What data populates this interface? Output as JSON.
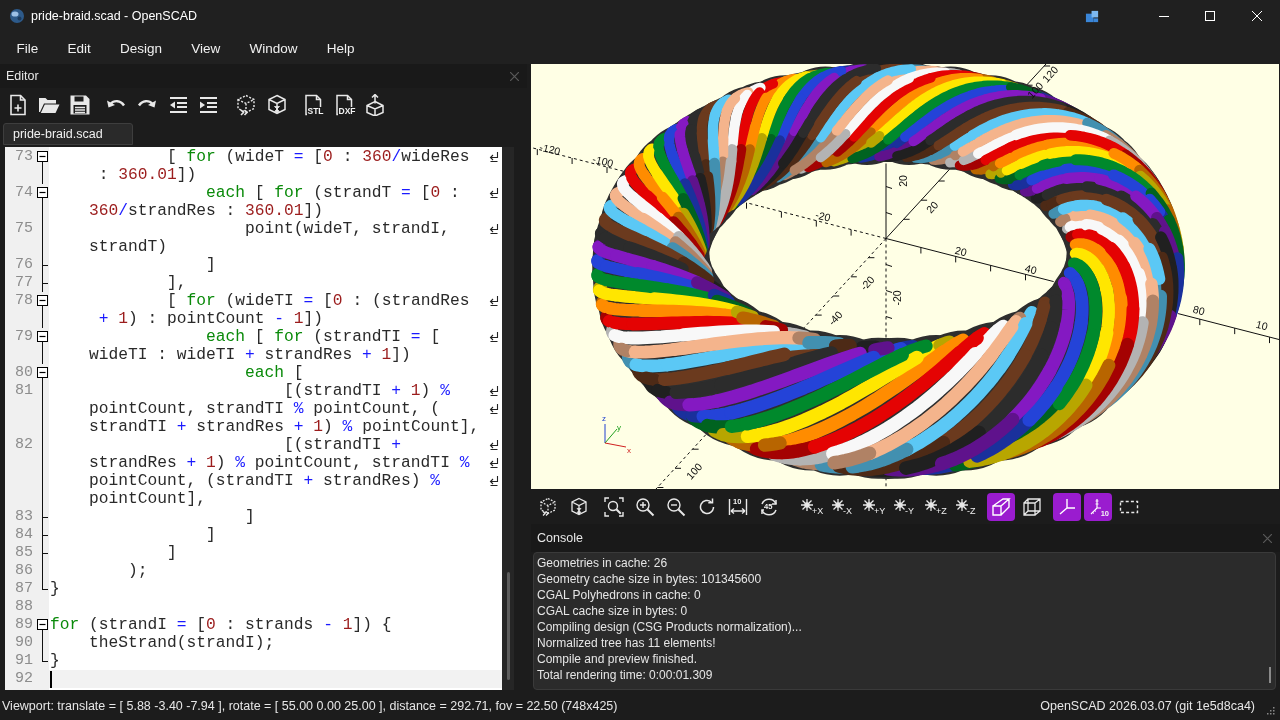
{
  "window": {
    "title": "pride-braid.scad - OpenSCAD"
  },
  "menu": [
    "File",
    "Edit",
    "Design",
    "View",
    "Window",
    "Help"
  ],
  "editor": {
    "title": "Editor",
    "export_buttons": [
      {
        "label": "STL"
      },
      {
        "label": "DXF"
      }
    ],
    "tabs": [
      {
        "label": "pride-braid.scad",
        "selected": true
      }
    ],
    "lines": [
      {
        "number": "73",
        "fold": {
          "kind": "toggle",
          "expanded": true
        },
        "current": false,
        "segments": [
          [
            {
              "kind": "text",
              "text": "            [ "
            },
            {
              "kind": "keyword",
              "text": "for"
            },
            {
              "kind": "text",
              "text": " (wideT "
            },
            {
              "kind": "operator",
              "text": "="
            },
            {
              "kind": "text",
              "text": " ["
            },
            {
              "kind": "number",
              "text": "0"
            },
            {
              "kind": "text",
              "text": " : "
            },
            {
              "kind": "number",
              "text": "360"
            },
            {
              "kind": "operator",
              "text": "/"
            },
            {
              "kind": "text",
              "text": "wideRes"
            }
          ],
          [
            {
              "kind": "text",
              "text": " : "
            },
            {
              "kind": "number",
              "text": "360.01"
            },
            {
              "kind": "text",
              "text": "])"
            }
          ]
        ]
      },
      {
        "number": "74",
        "fold": {
          "kind": "toggle",
          "expanded": true
        },
        "current": false,
        "segments": [
          [
            {
              "kind": "keyword",
              "text": "                each"
            },
            {
              "kind": "text",
              "text": " [ "
            },
            {
              "kind": "keyword",
              "text": "for"
            },
            {
              "kind": "text",
              "text": " (strandT "
            },
            {
              "kind": "operator",
              "text": "="
            },
            {
              "kind": "text",
              "text": " ["
            },
            {
              "kind": "number",
              "text": "0"
            },
            {
              "kind": "text",
              "text": " :"
            }
          ],
          [
            {
              "kind": "number",
              "text": "360"
            },
            {
              "kind": "operator",
              "text": "/"
            },
            {
              "kind": "text",
              "text": "strandRes : "
            },
            {
              "kind": "number",
              "text": "360.01"
            },
            {
              "kind": "text",
              "text": "])"
            }
          ]
        ]
      },
      {
        "number": "75",
        "fold": {
          "kind": "inside"
        },
        "current": false,
        "segments": [
          [
            {
              "kind": "text",
              "text": "                    point(wideT, strandI,"
            }
          ],
          [
            {
              "kind": "text",
              "text": "strandT)"
            }
          ]
        ]
      },
      {
        "number": "76",
        "fold": {
          "kind": "branch"
        },
        "current": false,
        "segments": [
          [
            {
              "kind": "text",
              "text": "                ]"
            }
          ]
        ]
      },
      {
        "number": "77",
        "fold": {
          "kind": "branch"
        },
        "current": false,
        "segments": [
          [
            {
              "kind": "text",
              "text": "            ],"
            }
          ]
        ]
      },
      {
        "number": "78",
        "fold": {
          "kind": "toggle",
          "expanded": true
        },
        "current": false,
        "segments": [
          [
            {
              "kind": "text",
              "text": "            [ "
            },
            {
              "kind": "keyword",
              "text": "for"
            },
            {
              "kind": "text",
              "text": " (wideTI "
            },
            {
              "kind": "operator",
              "text": "="
            },
            {
              "kind": "text",
              "text": " ["
            },
            {
              "kind": "number",
              "text": "0"
            },
            {
              "kind": "text",
              "text": " : (strandRes"
            }
          ],
          [
            {
              "kind": "operator",
              "text": " +"
            },
            {
              "kind": "number",
              "text": " 1"
            },
            {
              "kind": "text",
              "text": ") : pointCount "
            },
            {
              "kind": "operator",
              "text": "-"
            },
            {
              "kind": "number",
              "text": " 1"
            },
            {
              "kind": "text",
              "text": "])"
            }
          ]
        ]
      },
      {
        "number": "79",
        "fold": {
          "kind": "toggle",
          "expanded": true
        },
        "current": false,
        "segments": [
          [
            {
              "kind": "keyword",
              "text": "                each"
            },
            {
              "kind": "text",
              "text": " [ "
            },
            {
              "kind": "keyword",
              "text": "for"
            },
            {
              "kind": "text",
              "text": " (strandTI "
            },
            {
              "kind": "operator",
              "text": "="
            },
            {
              "kind": "text",
              "text": " ["
            }
          ],
          [
            {
              "kind": "text",
              "text": "wideTI : wideTI "
            },
            {
              "kind": "operator",
              "text": "+"
            },
            {
              "kind": "text",
              "text": " strandRes "
            },
            {
              "kind": "operator",
              "text": "+"
            },
            {
              "kind": "number",
              "text": " 1"
            },
            {
              "kind": "text",
              "text": "])"
            }
          ]
        ]
      },
      {
        "number": "80",
        "fold": {
          "kind": "toggle",
          "expanded": true
        },
        "current": false,
        "segments": [
          [
            {
              "kind": "keyword",
              "text": "                    each"
            },
            {
              "kind": "text",
              "text": " ["
            }
          ]
        ]
      },
      {
        "number": "81",
        "fold": {
          "kind": "inside"
        },
        "current": false,
        "segments": [
          [
            {
              "kind": "text",
              "text": "                        [(strandTI "
            },
            {
              "kind": "operator",
              "text": "+"
            },
            {
              "kind": "number",
              "text": " 1"
            },
            {
              "kind": "text",
              "text": ") "
            },
            {
              "kind": "operator",
              "text": "%"
            }
          ],
          [
            {
              "kind": "text",
              "text": "pointCount, strandTI "
            },
            {
              "kind": "operator",
              "text": "%"
            },
            {
              "kind": "text",
              "text": " pointCount, ("
            }
          ],
          [
            {
              "kind": "text",
              "text": "strandTI "
            },
            {
              "kind": "operator",
              "text": "+"
            },
            {
              "kind": "text",
              "text": " strandRes "
            },
            {
              "kind": "operator",
              "text": "+"
            },
            {
              "kind": "number",
              "text": " 1"
            },
            {
              "kind": "text",
              "text": ") "
            },
            {
              "kind": "operator",
              "text": "%"
            },
            {
              "kind": "text",
              "text": " pointCount],"
            }
          ]
        ]
      },
      {
        "number": "82",
        "fold": {
          "kind": "inside"
        },
        "current": false,
        "segments": [
          [
            {
              "kind": "text",
              "text": "                        [(strandTI "
            },
            {
              "kind": "operator",
              "text": "+"
            }
          ],
          [
            {
              "kind": "text",
              "text": "strandRes "
            },
            {
              "kind": "operator",
              "text": "+"
            },
            {
              "kind": "number",
              "text": " 1"
            },
            {
              "kind": "text",
              "text": ") "
            },
            {
              "kind": "operator",
              "text": "%"
            },
            {
              "kind": "text",
              "text": " pointCount, strandTI "
            },
            {
              "kind": "operator",
              "text": "%"
            }
          ],
          [
            {
              "kind": "text",
              "text": "pointCount, (strandTI "
            },
            {
              "kind": "operator",
              "text": "+"
            },
            {
              "kind": "text",
              "text": " strandRes) "
            },
            {
              "kind": "operator",
              "text": "%"
            }
          ],
          [
            {
              "kind": "text",
              "text": "pointCount],"
            }
          ]
        ]
      },
      {
        "number": "83",
        "fold": {
          "kind": "branch"
        },
        "current": false,
        "segments": [
          [
            {
              "kind": "text",
              "text": "                    ]"
            }
          ]
        ]
      },
      {
        "number": "84",
        "fold": {
          "kind": "branch"
        },
        "current": false,
        "segments": [
          [
            {
              "kind": "text",
              "text": "                ]"
            }
          ]
        ]
      },
      {
        "number": "85",
        "fold": {
          "kind": "branch"
        },
        "current": false,
        "segments": [
          [
            {
              "kind": "text",
              "text": "            ]"
            }
          ]
        ]
      },
      {
        "number": "86",
        "fold": {
          "kind": "inside"
        },
        "current": false,
        "segments": [
          [
            {
              "kind": "text",
              "text": "        );"
            }
          ]
        ]
      },
      {
        "number": "87",
        "fold": {
          "kind": "end"
        },
        "current": false,
        "segments": [
          [
            {
              "kind": "text",
              "text": "}"
            }
          ]
        ]
      },
      {
        "number": "88",
        "current": false
      },
      {
        "number": "89",
        "fold": {
          "kind": "toggle",
          "expanded": true
        },
        "current": false,
        "segments": [
          [
            {
              "kind": "keyword",
              "text": "for"
            },
            {
              "kind": "text",
              "text": " (strandI "
            },
            {
              "kind": "operator",
              "text": "="
            },
            {
              "kind": "text",
              "text": " ["
            },
            {
              "kind": "number",
              "text": "0"
            },
            {
              "kind": "text",
              "text": " : strands "
            },
            {
              "kind": "operator",
              "text": "-"
            },
            {
              "kind": "number",
              "text": " 1"
            },
            {
              "kind": "text",
              "text": "]) {"
            }
          ]
        ]
      },
      {
        "number": "90",
        "fold": {
          "kind": "inside"
        },
        "current": false,
        "segments": [
          [
            {
              "kind": "text",
              "text": "    theStrand(strandI);"
            }
          ]
        ]
      },
      {
        "number": "91",
        "fold": {
          "kind": "end"
        },
        "current": false,
        "segments": [
          [
            {
              "kind": "text",
              "text": "}"
            }
          ]
        ]
      },
      {
        "number": "92",
        "current": true
      }
    ]
  },
  "viewport": {
    "scale_labels": [
      "-120",
      "-100",
      "120",
      "100",
      "20",
      "20",
      "-20",
      "20",
      "40",
      "-20",
      "-20",
      "-40",
      "80",
      "10",
      "100"
    ],
    "gizmo_labels": [
      "z",
      "y",
      "x"
    ],
    "toolbar": {
      "measure_label": "10",
      "rotate_label": "45",
      "view_buttons": [
        {
          "label": "+X"
        },
        {
          "label": "-X"
        },
        {
          "label": "+Y"
        },
        {
          "label": "-Y"
        },
        {
          "label": "+Z"
        },
        {
          "label": "-Z"
        }
      ],
      "projections": [
        {
          "selected": true
        },
        {
          "selected": false
        }
      ],
      "axes": {
        "on": true
      },
      "scale_markers": {
        "on": true,
        "label": "10"
      },
      "edges": {
        "on": false
      }
    }
  },
  "console": {
    "title": "Console",
    "lines": [
      "Geometries in cache: 26",
      "Geometry cache size in bytes: 101345600",
      "CGAL Polyhedrons in cache: 0",
      "CGAL cache size in bytes: 0",
      "Compiling design (CSG Products normalization)...",
      "Normalized tree has 11 elements!",
      "Compile and preview finished.",
      "Total rendering time: 0:00:01.309"
    ]
  },
  "status_bar": {
    "viewport_info": "Viewport: translate = [ 5.88 -3.40 -7.94 ], rotate = [ 55.00 0.00 25.00 ], distance = 292.71, fov = 22.50 (748x425)",
    "version": "OpenSCAD 2026.03.07 (git 1e5d8ca4)"
  }
}
